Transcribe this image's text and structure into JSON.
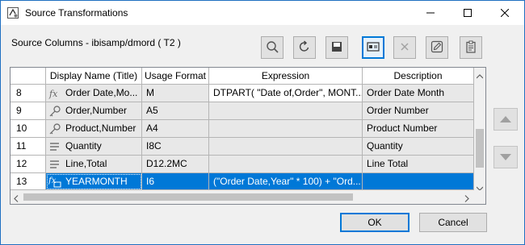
{
  "window": {
    "title": "Source Transformations"
  },
  "subtitle": "Source Columns - ibisamp/dmord ( T2 )",
  "table": {
    "headers": [
      "Display Name (Title)",
      "Usage Format",
      "Expression",
      "Description"
    ],
    "rows": [
      {
        "num": "8",
        "name": "Order Date,Mo...",
        "icon": "function-icon",
        "format": "M",
        "expression": "DTPART( \"Date of,Order\", MONT...",
        "description": "Order Date Month"
      },
      {
        "num": "9",
        "name": "Order,Number",
        "icon": "key-icon",
        "format": "A5",
        "expression": "",
        "description": "Order Number"
      },
      {
        "num": "10",
        "name": "Product,Number",
        "icon": "key-icon",
        "format": "A4",
        "expression": "",
        "description": "Product Number"
      },
      {
        "num": "11",
        "name": "Quantity",
        "icon": "measure-icon",
        "format": "I8C",
        "expression": "",
        "description": "Quantity"
      },
      {
        "num": "12",
        "name": "Line,Total",
        "icon": "measure-icon",
        "format": "D12.2MC",
        "expression": "",
        "description": "Line Total"
      },
      {
        "num": "13",
        "name": "YEARMONTH",
        "icon": "computed-function-icon",
        "format": "I6",
        "expression": "(\"Order Date,Year\" * 100) + \"Ord...",
        "description": ""
      }
    ],
    "selected_row": "13"
  },
  "buttons": {
    "ok": "OK",
    "cancel": "Cancel"
  }
}
